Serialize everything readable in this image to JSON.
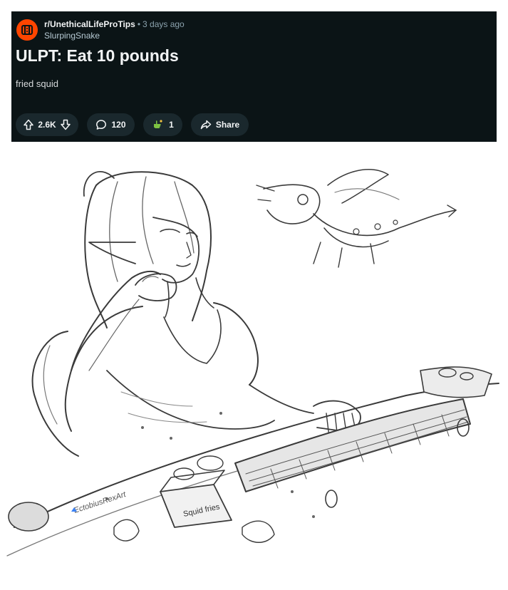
{
  "post": {
    "subreddit": "r/UnethicalLifeProTips",
    "separator": "•",
    "time_ago": "3 days ago",
    "author": "SlurpingSnake",
    "title": "ULPT: Eat 10 pounds",
    "body": "fried squid"
  },
  "actions": {
    "upvote_icon": "arrow-up-icon",
    "score": "2.6K",
    "downvote_icon": "arrow-down-icon",
    "comment_icon": "speech-bubble-icon",
    "comments": "120",
    "award_icon": "award-hand-icon",
    "awards": "1",
    "share_icon": "share-arrow-icon",
    "share_label": "Share"
  },
  "illustration": {
    "signature": "EctobiusRexArt",
    "box_label": "Squid fries",
    "style": "grayscale pencil sketch"
  },
  "colors": {
    "card_bg": "#0b1416",
    "pill_bg": "#1a282d",
    "brand_orange": "#ff4500",
    "text_primary": "#f2f4f5",
    "text_muted": "#8ba2ad",
    "award_green": "#7cc242"
  }
}
